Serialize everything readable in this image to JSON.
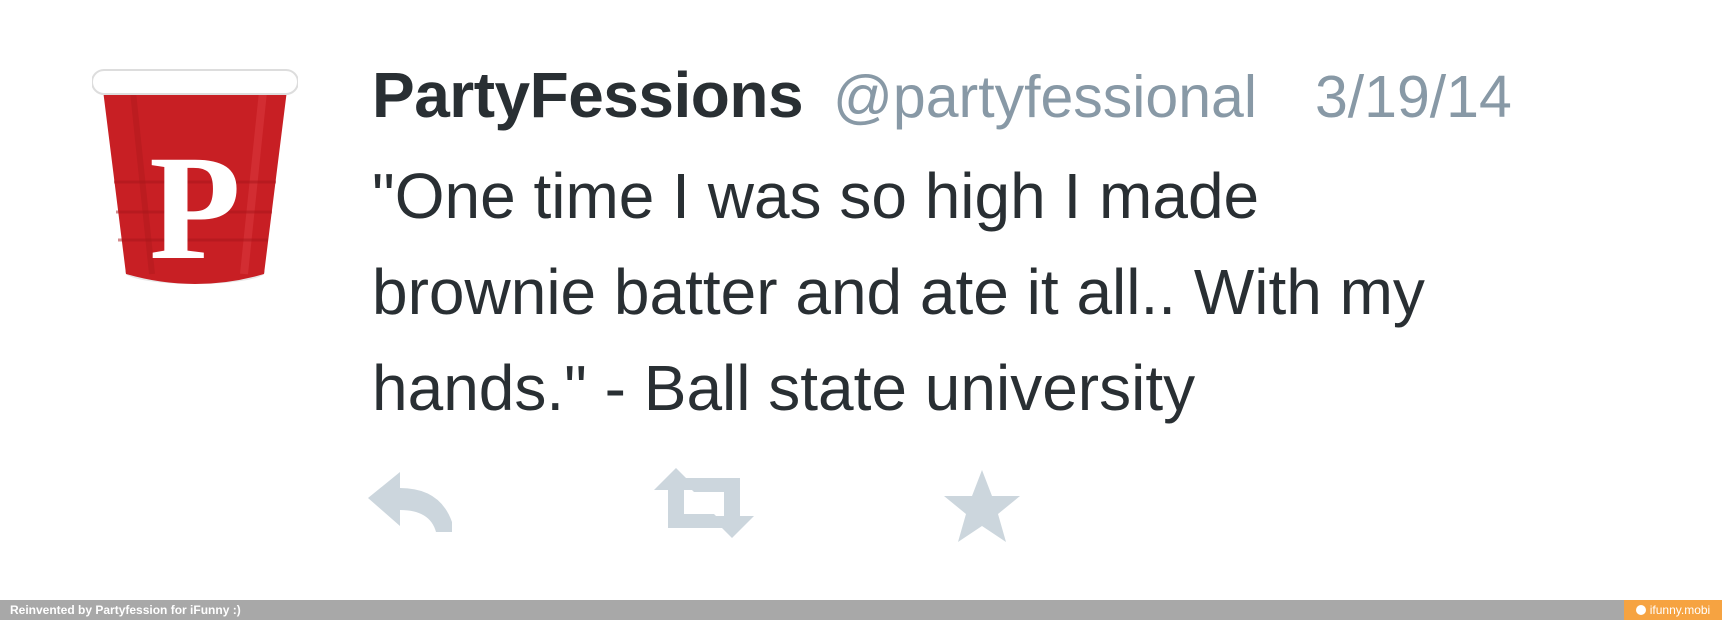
{
  "tweet": {
    "display_name": "PartyFessions",
    "handle": "@partyfessional",
    "date": "3/19/14",
    "text": "\"One time I was so high I made\nbrownie batter and ate it all.. With my\nhands.\" - Ball state university",
    "avatar_letter": "P"
  },
  "actions": {
    "reply_icon": "reply-icon",
    "retweet_icon": "retweet-icon",
    "favorite_icon": "star-icon"
  },
  "footer": {
    "credit": "Reinvented by Partyfession for iFunny :)",
    "brand": "ifunny.mobi"
  },
  "colors": {
    "text": "#292f33",
    "muted": "#8899a6",
    "icon": "#ccd6dd",
    "cup_red": "#c81f24",
    "footer_bar": "#a8a8a8",
    "brand_orange": "#f6a341"
  }
}
